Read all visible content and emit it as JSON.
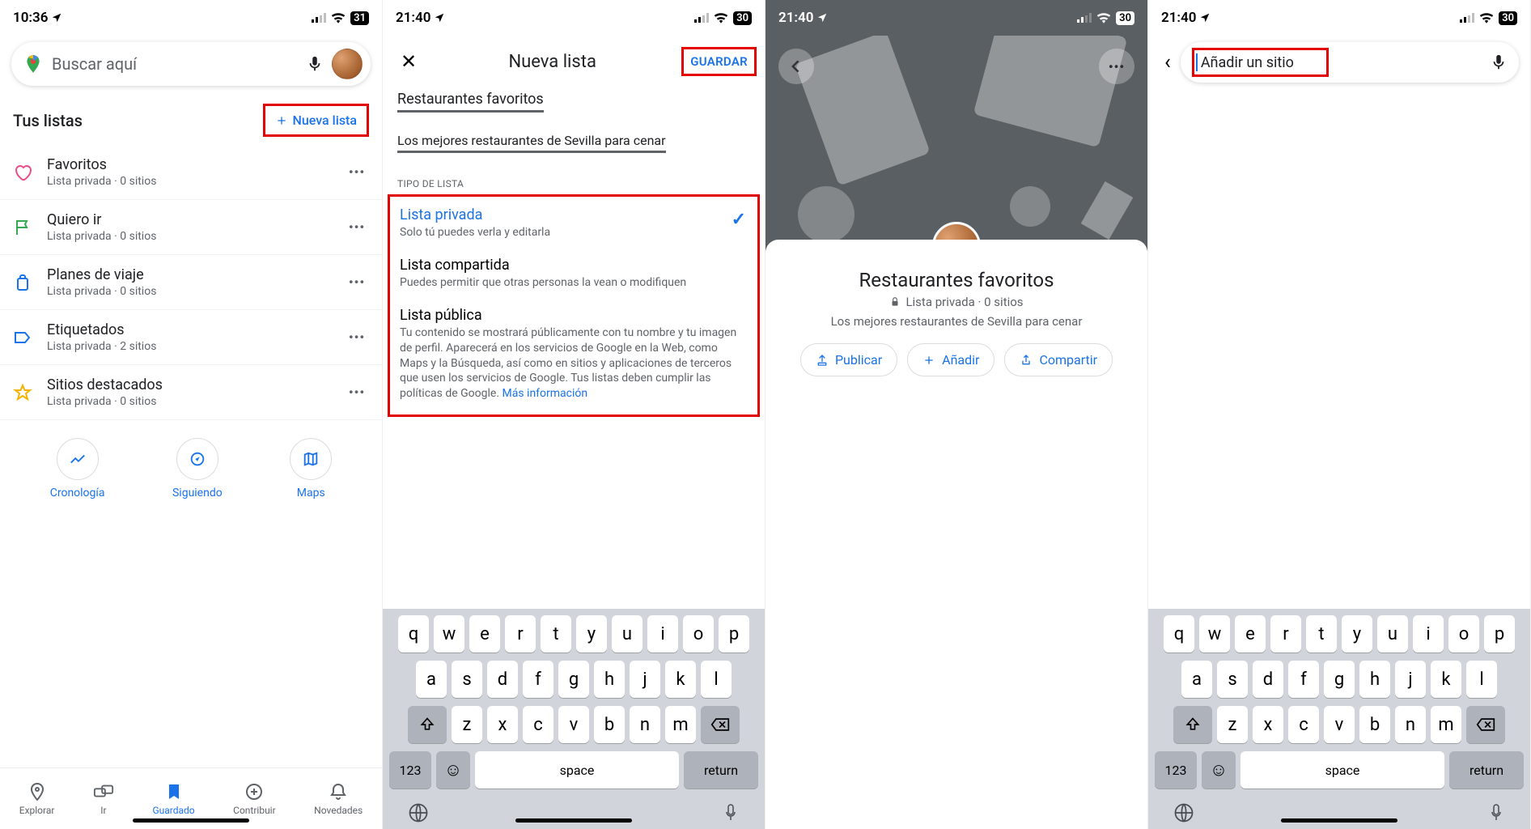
{
  "screen1": {
    "status": {
      "time": "10:36",
      "battery": "31"
    },
    "search_placeholder": "Buscar aquí",
    "lists_title": "Tus listas",
    "new_list": "Nueva lista",
    "items": [
      {
        "name": "Favoritos",
        "meta": "Lista privada · 0 sitios",
        "icon": "heart",
        "color": "#ea4c89"
      },
      {
        "name": "Quiero ir",
        "meta": "Lista privada · 0 sitios",
        "icon": "flag",
        "color": "#34a853"
      },
      {
        "name": "Planes de viaje",
        "meta": "Lista privada · 0 sitios",
        "icon": "suitcase",
        "color": "#1a73e8"
      },
      {
        "name": "Etiquetados",
        "meta": "Lista privada · 2 sitios",
        "icon": "label",
        "color": "#1a73e8"
      },
      {
        "name": "Sitios destacados",
        "meta": "Lista privada · 0 sitios",
        "icon": "star",
        "color": "#f5b400"
      }
    ],
    "tabs": [
      {
        "label": "Cronología"
      },
      {
        "label": "Siguiendo"
      },
      {
        "label": "Maps"
      }
    ],
    "nav": [
      {
        "label": "Explorar"
      },
      {
        "label": "Ir"
      },
      {
        "label": "Guardado"
      },
      {
        "label": "Contribuir"
      },
      {
        "label": "Novedades"
      }
    ]
  },
  "screen2": {
    "status": {
      "time": "21:40",
      "battery": "30"
    },
    "title": "Nueva lista",
    "save": "GUARDAR",
    "name_value": "Restaurantes favoritos",
    "desc_value": "Los mejores restaurantes de Sevilla para cenar",
    "section_label": "TIPO DE LISTA",
    "options": [
      {
        "title": "Lista privada",
        "desc": "Solo tú puedes verla y editarla",
        "selected": true
      },
      {
        "title": "Lista compartida",
        "desc": "Puedes permitir que otras personas la vean o modifiquen"
      },
      {
        "title": "Lista pública",
        "desc": "Tu contenido se mostrará públicamente con tu nombre y tu imagen de perfil. Aparecerá en los servicios de Google en la Web, como Maps y la Búsqueda, así como en sitios y aplicaciones de terceros que usen los servicios de Google. Tus listas deben cumplir las políticas de Google. ",
        "link": "Más información"
      }
    ],
    "keyboard": {
      "row1": [
        "q",
        "w",
        "e",
        "r",
        "t",
        "y",
        "u",
        "i",
        "o",
        "p"
      ],
      "row2": [
        "a",
        "s",
        "d",
        "f",
        "g",
        "h",
        "j",
        "k",
        "l"
      ],
      "row3": [
        "z",
        "x",
        "c",
        "v",
        "b",
        "n",
        "m"
      ],
      "num": "123",
      "space": "space",
      "return": "return"
    }
  },
  "screen3": {
    "status": {
      "time": "21:40",
      "battery": "30"
    },
    "title": "Restaurantes favoritos",
    "meta": "Lista privada · 0 sitios",
    "desc": "Los mejores restaurantes de Sevilla para cenar",
    "actions": {
      "publish": "Publicar",
      "add": "Añadir",
      "share": "Compartir"
    }
  },
  "screen4": {
    "status": {
      "time": "21:40",
      "battery": "30"
    },
    "placeholder": "Añadir un sitio",
    "keyboard": {
      "row1": [
        "q",
        "w",
        "e",
        "r",
        "t",
        "y",
        "u",
        "i",
        "o",
        "p"
      ],
      "row2": [
        "a",
        "s",
        "d",
        "f",
        "g",
        "h",
        "j",
        "k",
        "l"
      ],
      "row3": [
        "z",
        "x",
        "c",
        "v",
        "b",
        "n",
        "m"
      ],
      "num": "123",
      "space": "space",
      "return": "return"
    }
  }
}
